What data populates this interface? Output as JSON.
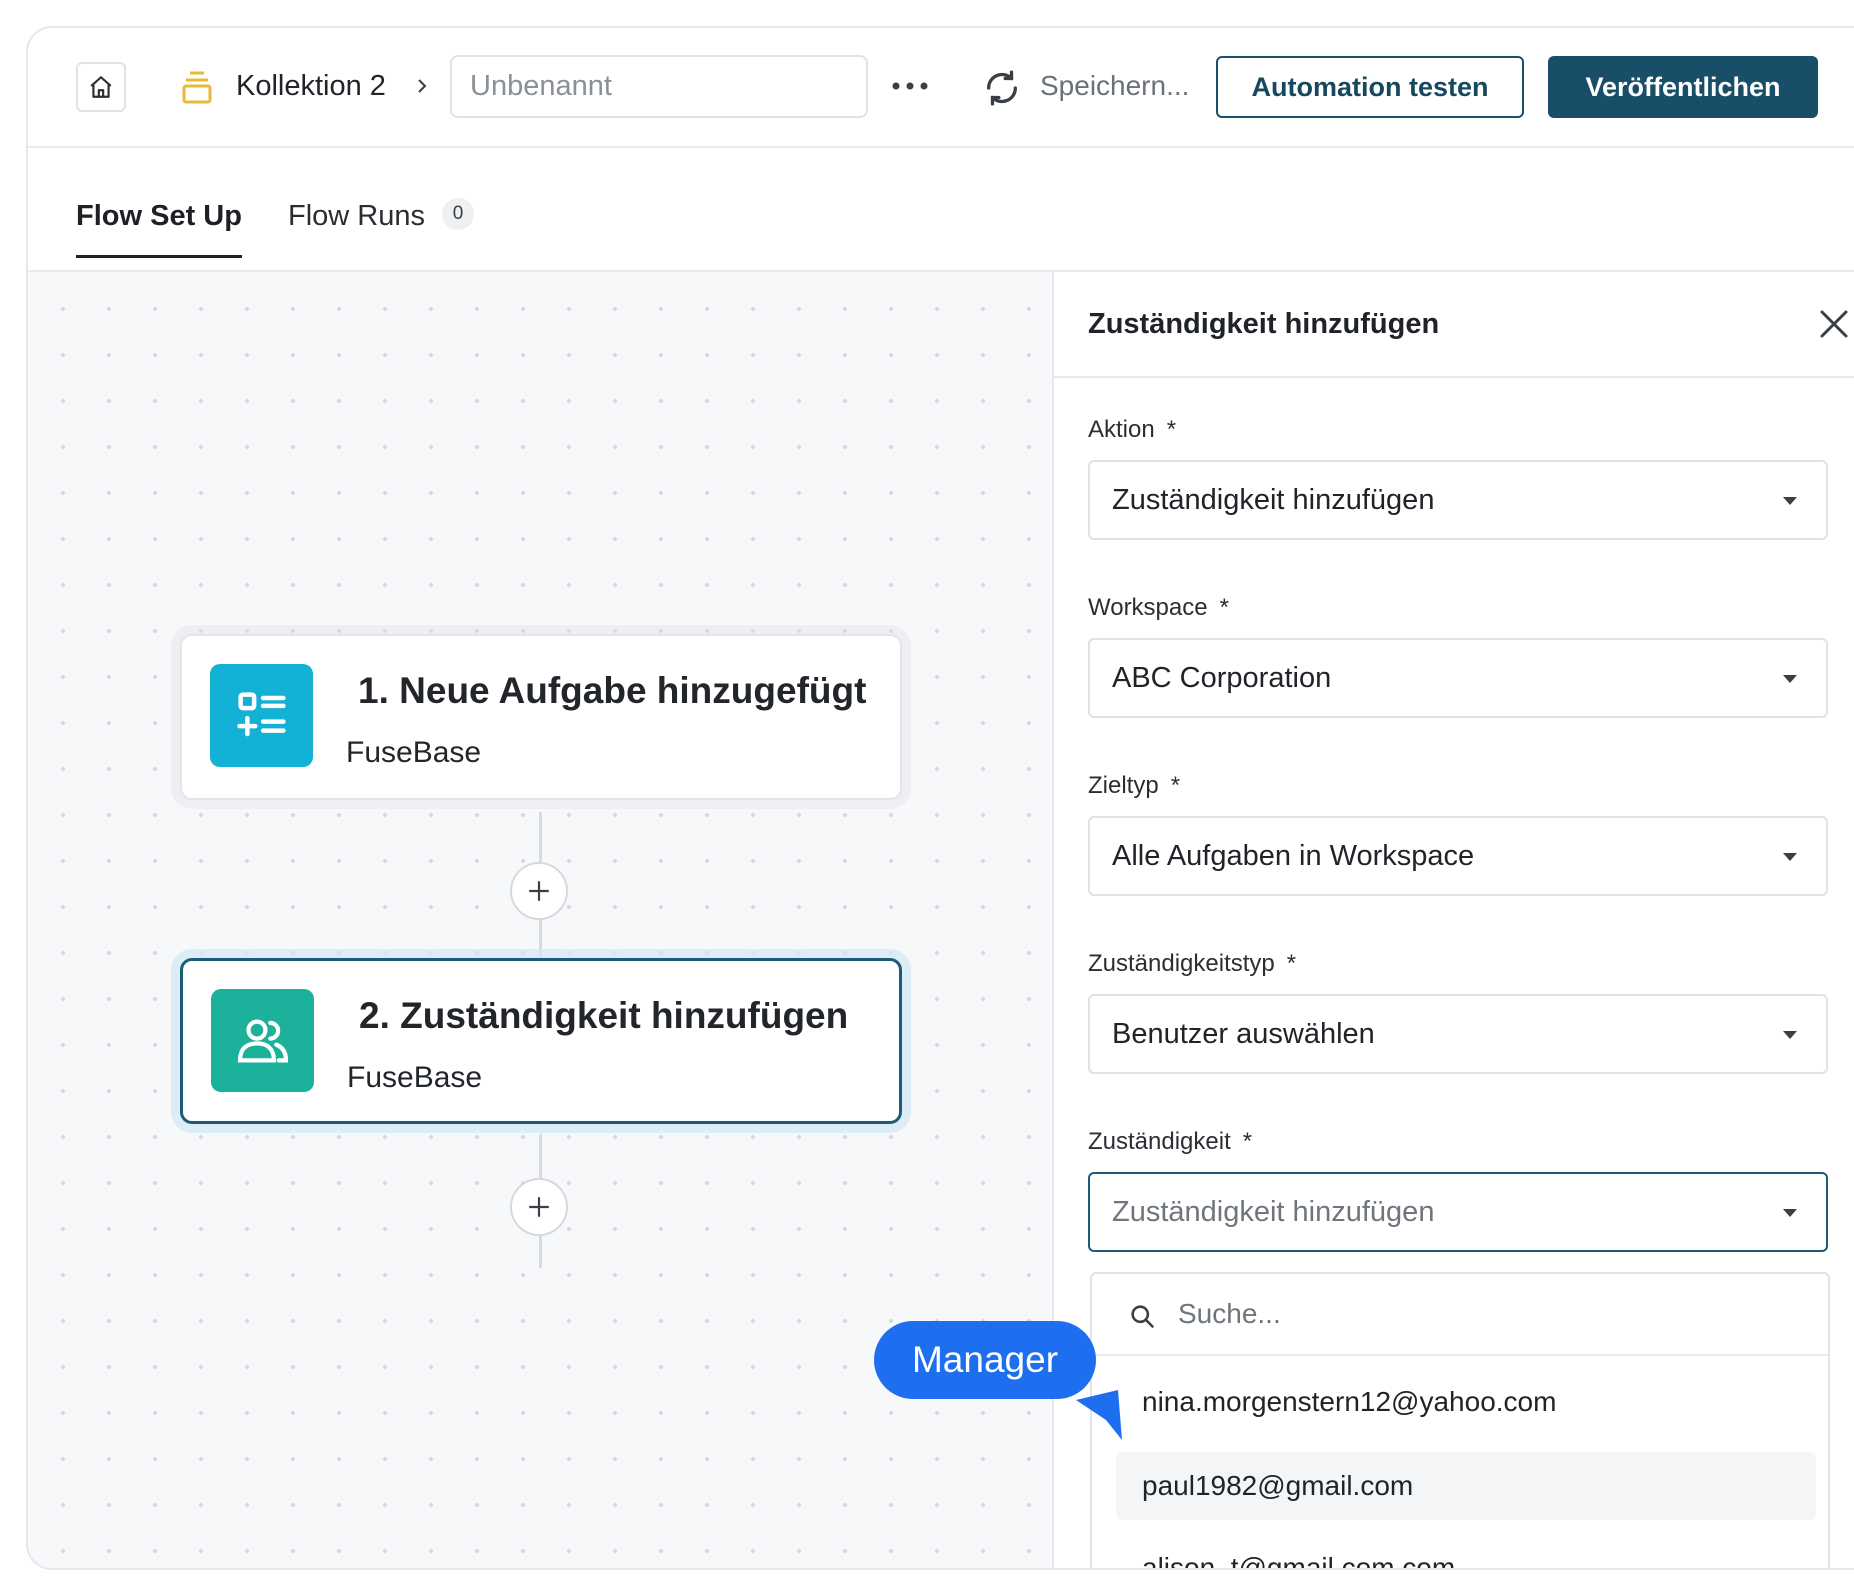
{
  "header": {
    "collection_name": "Kollektion 2",
    "title_placeholder": "Unbenannt",
    "saving_text": "Speichern...",
    "test_button": "Automation testen",
    "publish_button": "Veröffentlichen"
  },
  "tabs": [
    {
      "label": "Flow Set Up",
      "active": true
    },
    {
      "label": "Flow Runs",
      "count": "0"
    }
  ],
  "flow": {
    "nodes": [
      {
        "number": "1.",
        "title": "Neue Aufgabe hinzugefügt",
        "app": "FuseBase",
        "icon": "task-list-icon",
        "color": "#14b1d6"
      },
      {
        "number": "2.",
        "title": "Zuständigkeit hinzufügen",
        "app": "FuseBase",
        "icon": "users-icon",
        "color": "#1bb19a",
        "selected": true
      }
    ]
  },
  "panel": {
    "title": "Zuständigkeit hinzufügen",
    "fields": [
      {
        "label": "Aktion",
        "required": "*",
        "value": "Zuständigkeit hinzufügen"
      },
      {
        "label": "Workspace",
        "required": "*",
        "value": "ABC Corporation"
      },
      {
        "label": "Zieltyp",
        "required": "*",
        "value": "Alle Aufgaben in Workspace"
      },
      {
        "label": "Zuständigkeitstyp",
        "required": "*",
        "value": "Benutzer auswählen"
      },
      {
        "label": "Zuständigkeit",
        "required": "*",
        "placeholder": "Zuständigkeit hinzufügen"
      }
    ],
    "dropdown": {
      "search_placeholder": "Suche...",
      "options": [
        "nina.morgenstern12@yahoo.com",
        "paul1982@gmail.com",
        "alison_t@gmail.com.com"
      ],
      "hovered_option": "paul1982@gmail.com"
    }
  },
  "callout": {
    "label": "Manager"
  },
  "colors": {
    "primary": "#184e68",
    "accent_blue": "#1e6ef0",
    "task_icon_bg": "#14b1d6",
    "user_icon_bg": "#1bb19a",
    "folder_icon": "#e9b93a"
  }
}
